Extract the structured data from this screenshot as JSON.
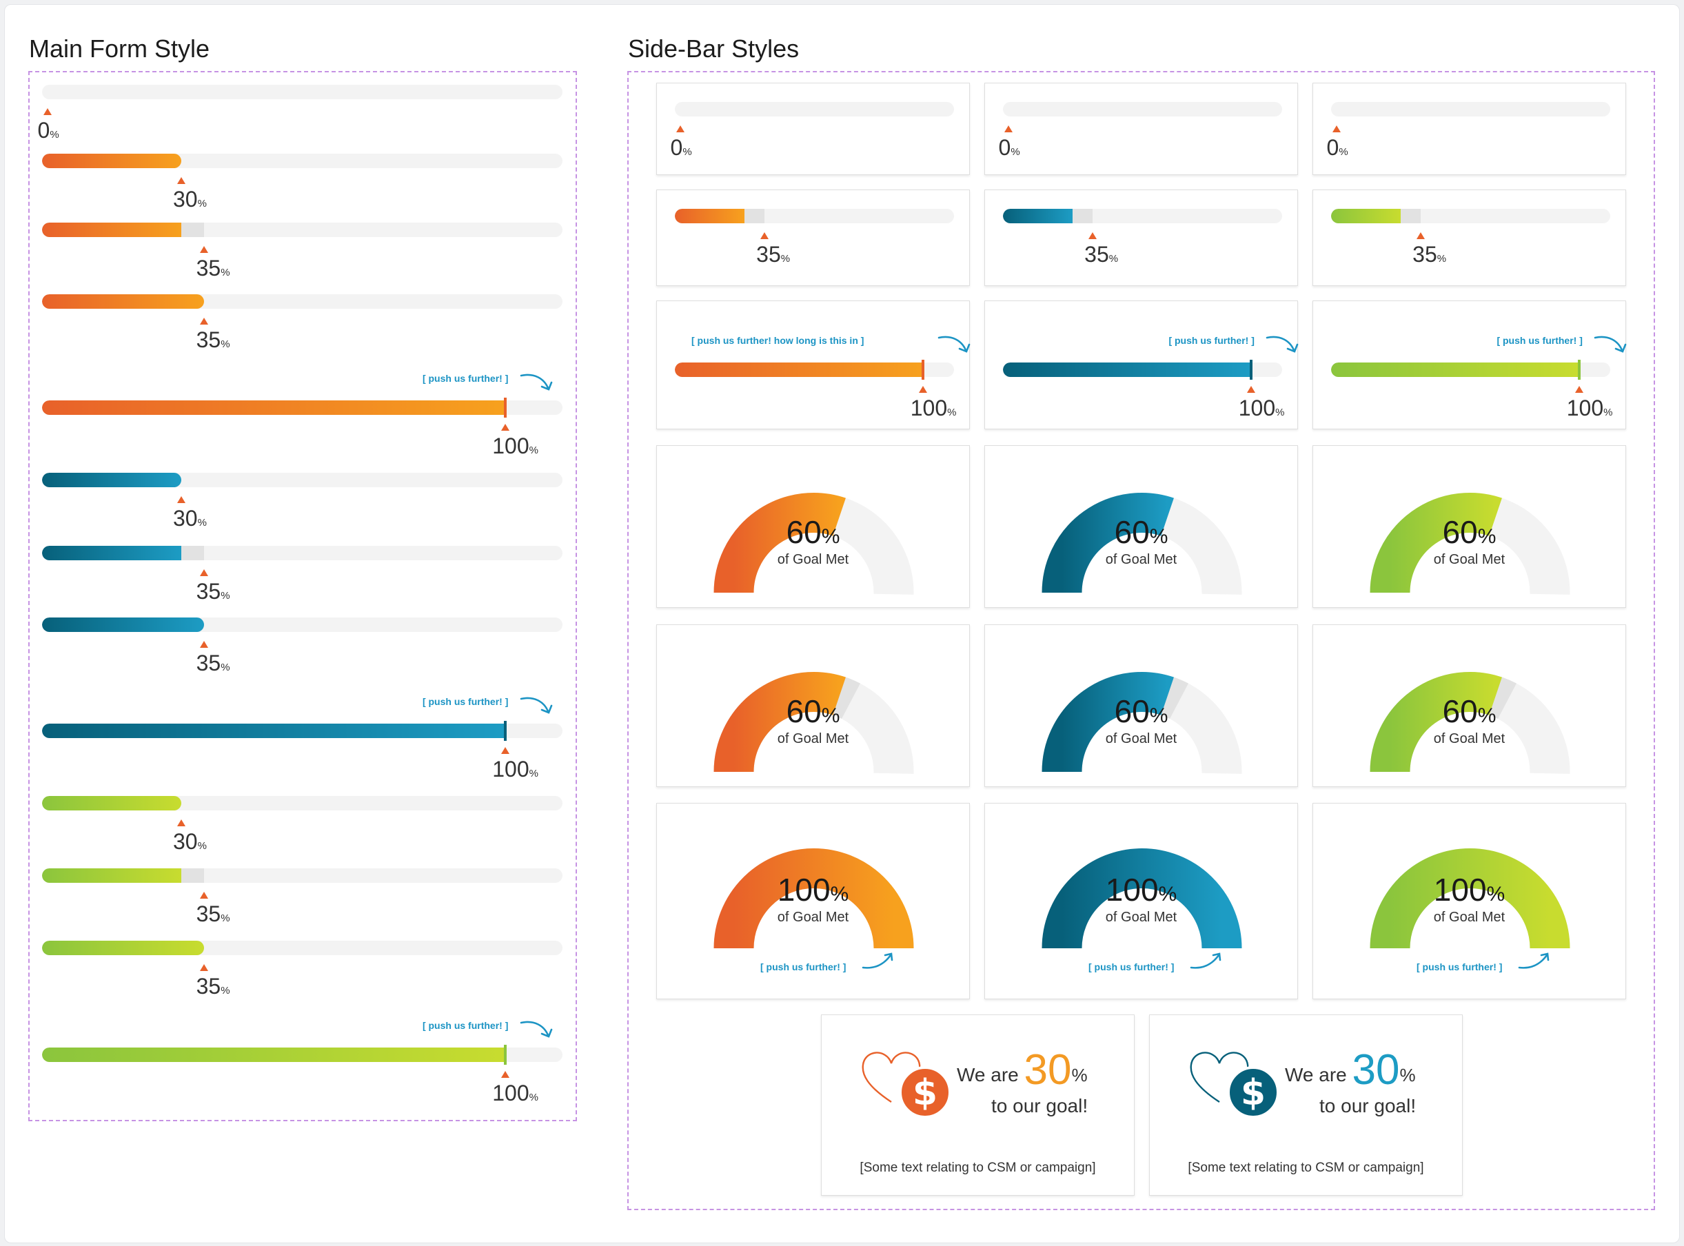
{
  "main_title": "Main Form Style",
  "side_title": "Side-Bar Styles",
  "push_label": "[ push us further! ]",
  "push_label_long": "[ push us further!  how long is this in ]",
  "colors": {
    "orange": "#e8612a",
    "orange_light": "#f7a11e",
    "blue": "#07607a",
    "blue_light": "#1d9cc4",
    "green": "#8bc53d",
    "green_light": "#c8dc2f",
    "track": "#f3f3f3",
    "pending": "#e2e2e2",
    "link": "#1c94c4",
    "frame": "#c693e3"
  },
  "main_bars": [
    {
      "value": 0,
      "pending": 0,
      "color": "orange",
      "label": "0",
      "push": false
    },
    {
      "value": 30,
      "pending": 0,
      "color": "orange",
      "label": "30",
      "push": false
    },
    {
      "value": 30,
      "pending": 35,
      "color": "orange",
      "label": "35",
      "push": false
    },
    {
      "value": 35,
      "pending": 0,
      "color": "orange",
      "label": "35",
      "push": false
    },
    {
      "value": 100,
      "pending": 0,
      "color": "orange",
      "label": "100",
      "push": true
    },
    {
      "value": 30,
      "pending": 0,
      "color": "blue",
      "label": "30",
      "push": false
    },
    {
      "value": 30,
      "pending": 35,
      "color": "blue",
      "label": "35",
      "push": false
    },
    {
      "value": 35,
      "pending": 0,
      "color": "blue",
      "label": "35",
      "push": false
    },
    {
      "value": 100,
      "pending": 0,
      "color": "blue",
      "label": "100",
      "push": true
    },
    {
      "value": 30,
      "pending": 0,
      "color": "green",
      "label": "30",
      "push": false
    },
    {
      "value": 30,
      "pending": 35,
      "color": "green",
      "label": "35",
      "push": false
    },
    {
      "value": 35,
      "pending": 0,
      "color": "green",
      "label": "35",
      "push": false
    },
    {
      "value": 100,
      "pending": 0,
      "color": "green",
      "label": "100",
      "push": true
    }
  ],
  "side_bar_rows": [
    {
      "value": 0,
      "pending": 0,
      "label": "0",
      "push": false
    },
    {
      "value": 28,
      "pending": 36,
      "label": "35",
      "push": false
    },
    {
      "value": 100,
      "pending": 0,
      "label": "100",
      "push": true
    }
  ],
  "side_colors": [
    "orange",
    "blue",
    "green"
  ],
  "gauge_rows": [
    {
      "value": 60,
      "pending": 0,
      "label": "60",
      "push": false
    },
    {
      "value": 60,
      "pending": 65,
      "label": "60",
      "push": false
    },
    {
      "value": 100,
      "pending": 0,
      "label": "100",
      "push": true
    }
  ],
  "gauge_sub": "of Goal Met",
  "percent_sign": "%",
  "goal_cards": [
    {
      "color": "orange",
      "prefix": "We are",
      "value": "30",
      "suffix": "to our goal!",
      "note": "[Some text relating to CSM or campaign]"
    },
    {
      "color": "blue",
      "prefix": "We are",
      "value": "30",
      "suffix": "to our goal!",
      "note": "[Some text relating to CSM or campaign]"
    }
  ]
}
